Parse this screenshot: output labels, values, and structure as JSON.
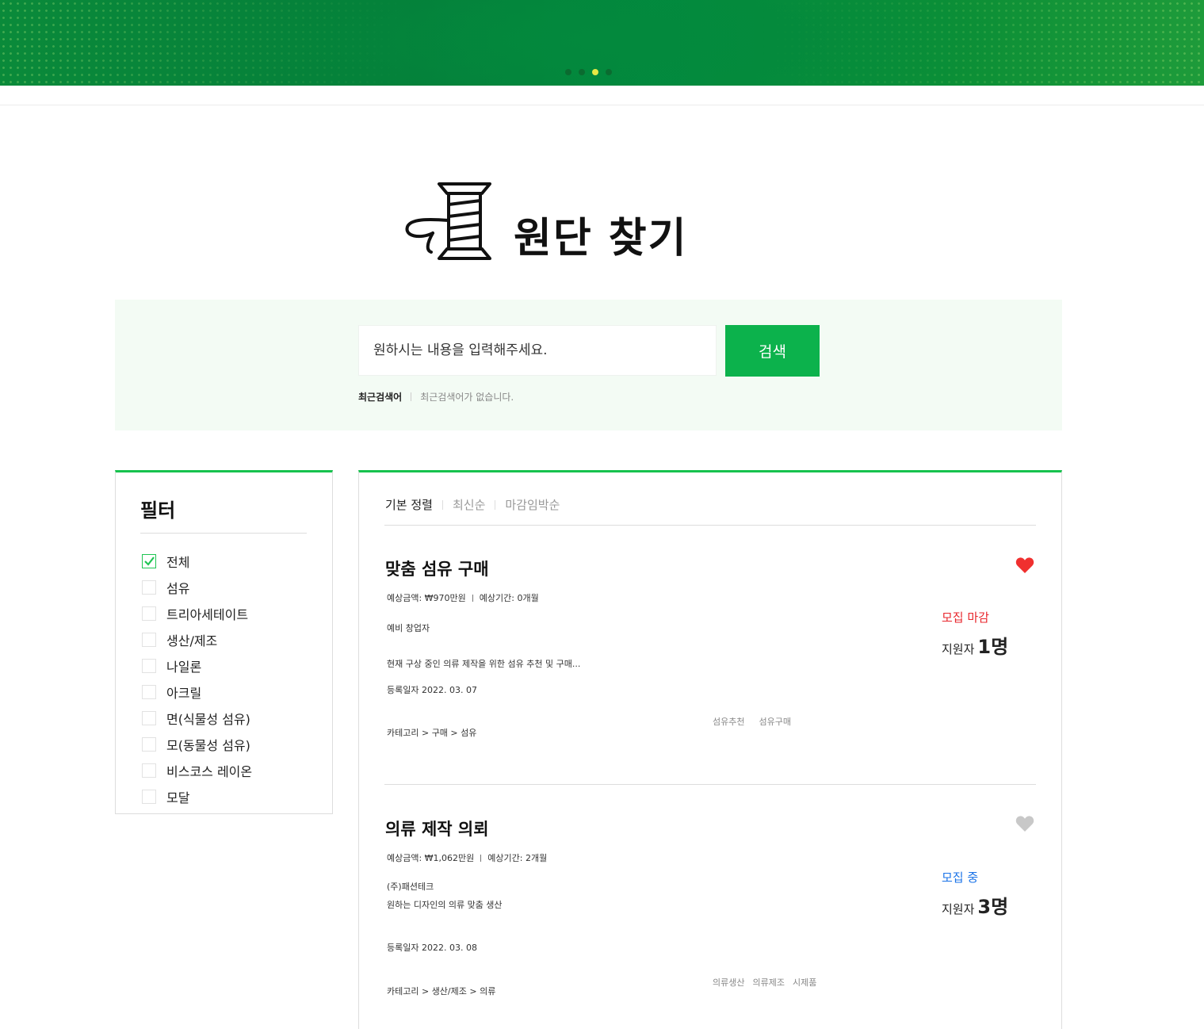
{
  "banner": {
    "slides": 4,
    "active_slide": 3
  },
  "page": {
    "title": "원단 찾기"
  },
  "search": {
    "placeholder": "원하시는 내용을 입력해주세요.",
    "button": "검색",
    "recent_label": "최근검색어",
    "recent_empty": "최근검색어가 없습니다."
  },
  "filter": {
    "title": "필터",
    "items": [
      {
        "label": "전체",
        "checked": true
      },
      {
        "label": "섬유",
        "checked": false
      },
      {
        "label": "트리아세테이트",
        "checked": false
      },
      {
        "label": "생산/제조",
        "checked": false
      },
      {
        "label": "나일론",
        "checked": false
      },
      {
        "label": "아크릴",
        "checked": false
      },
      {
        "label": "면(식물성 섬유)",
        "checked": false
      },
      {
        "label": "모(동물성 섬유)",
        "checked": false
      },
      {
        "label": "비스코스 레이온",
        "checked": false
      },
      {
        "label": "모달",
        "checked": false
      }
    ]
  },
  "sort": {
    "options": [
      "기본 정렬",
      "최신순",
      "마감임박순"
    ],
    "active": 0
  },
  "colors": {
    "accent": "#0cb24c",
    "closed": "#e8262c",
    "open": "#1a73e8",
    "heart_on": "#f0302f",
    "heart_off": "#c8c8c8"
  },
  "listings": [
    {
      "title": "맞춤 섬유 구매",
      "price": "예상금액: ₩970만원",
      "period": "예상기간: 0개월",
      "company": "예비 창업자",
      "description": "현재 구상 중인 의류 제작을 위한 섬유 추천 및 구매...",
      "registered": "등록일자 2022. 03. 07",
      "category": "카테고리 > 구매 > 섬유",
      "tags": [
        "섬유추천",
        "섬유구매"
      ],
      "status": "모집 마감",
      "applicants_label": "지원자",
      "applicants_count": "1명",
      "liked": true
    },
    {
      "title": "의류 제작 의뢰",
      "price": "예상금액: ₩1,062만원",
      "period": "예상기간: 2개월",
      "company": "(주)패션테크",
      "description": "원하는 디자인의 의류 맞춤 생산",
      "registered": "등록일자 2022. 03. 08",
      "category": "카테고리 > 생산/제조 > 의류",
      "tags": [
        "의류생산",
        "의류제조",
        "시제품"
      ],
      "status": "모집 중",
      "applicants_label": "지원자",
      "applicants_count": "3명",
      "liked": false
    }
  ]
}
